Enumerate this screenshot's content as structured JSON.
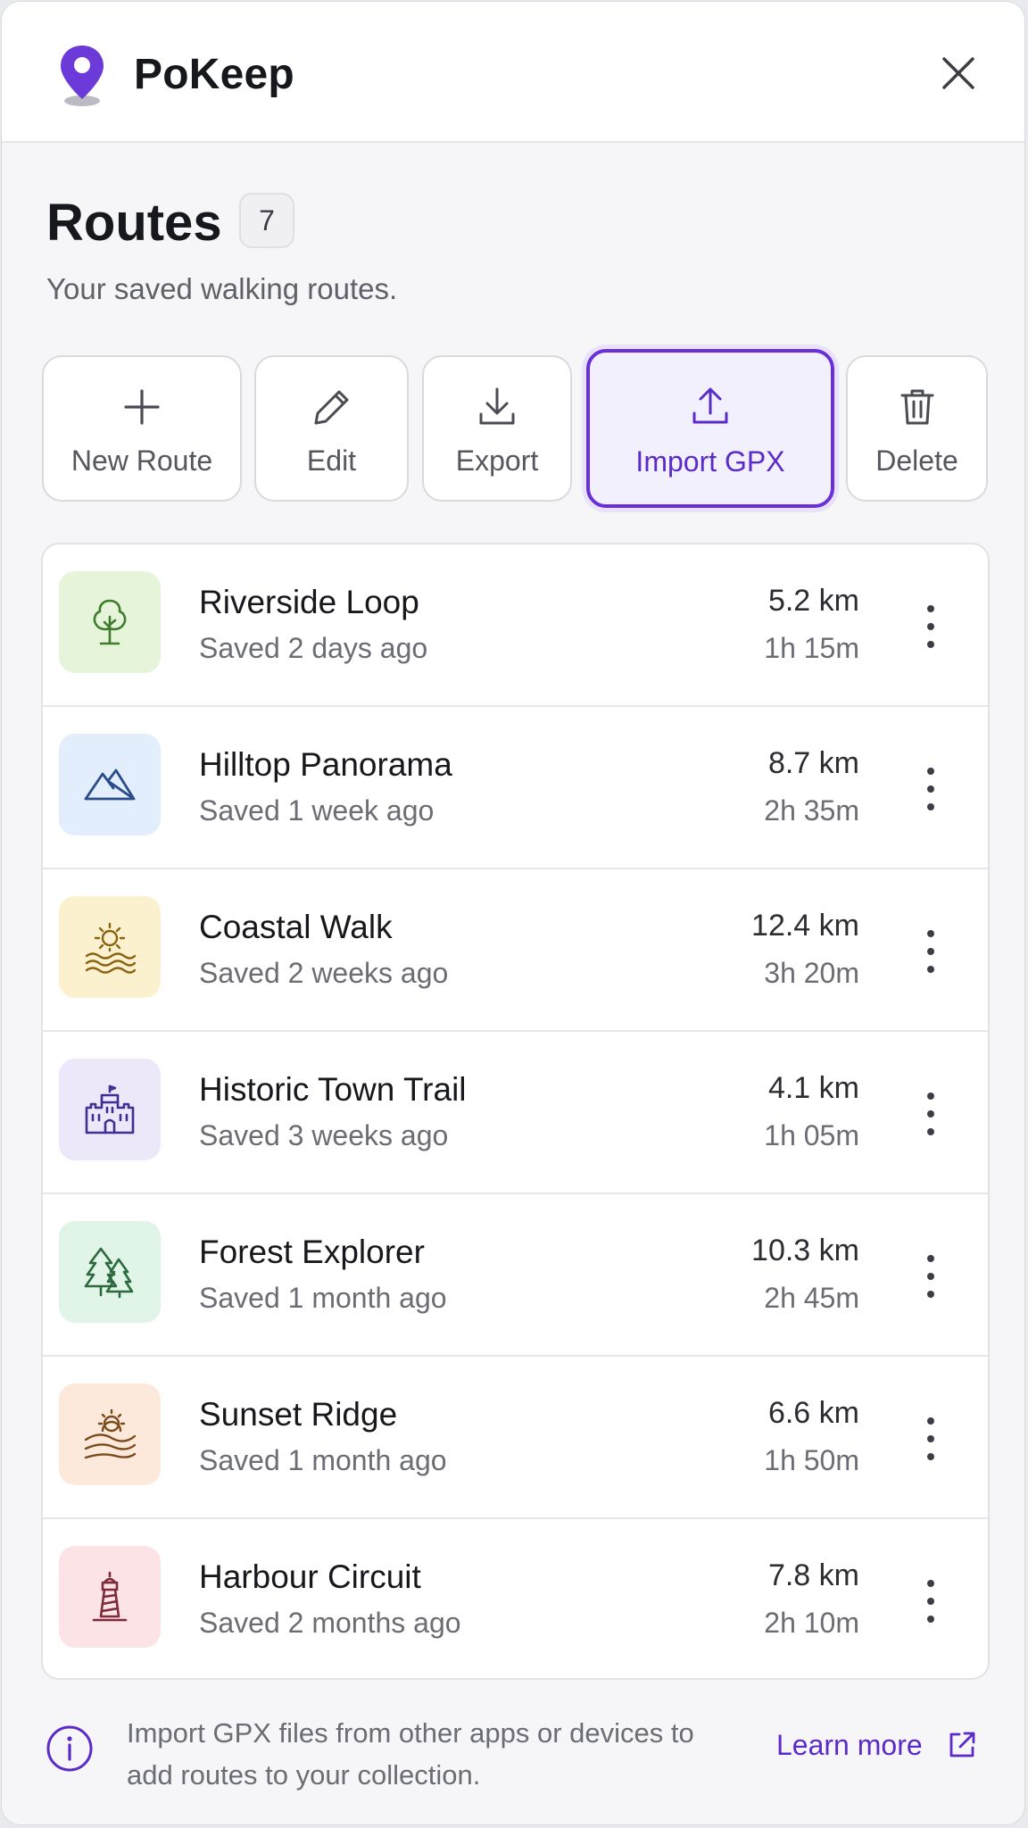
{
  "app": {
    "title": "PoKeep"
  },
  "page": {
    "title": "Routes",
    "count": "7",
    "subtitle": "Your saved walking routes."
  },
  "toolbar": {
    "new_route": "New Route",
    "edit": "Edit",
    "export": "Export",
    "import_gpx": "Import GPX",
    "delete": "Delete",
    "active": "import_gpx"
  },
  "routes": [
    {
      "name": "Riverside Loop",
      "saved": "Saved 2 days ago",
      "distance": "5.2 km",
      "duration": "1h 15m",
      "icon": "tree-icon",
      "tile_color": "#e6f4da",
      "icon_color": "#3e7b2a"
    },
    {
      "name": "Hilltop Panorama",
      "saved": "Saved 1 week ago",
      "distance": "8.7 km",
      "duration": "2h 35m",
      "icon": "mountain-icon",
      "tile_color": "#e3eefc",
      "icon_color": "#2a4c8a"
    },
    {
      "name": "Coastal Walk",
      "saved": "Saved 2 weeks ago",
      "distance": "12.4 km",
      "duration": "3h 20m",
      "icon": "sun-waves-icon",
      "tile_color": "#fcf1cf",
      "icon_color": "#8a6312"
    },
    {
      "name": "Historic Town Trail",
      "saved": "Saved 3 weeks ago",
      "distance": "4.1 km",
      "duration": "1h 05m",
      "icon": "castle-icon",
      "tile_color": "#ece8fa",
      "icon_color": "#3f2f90"
    },
    {
      "name": "Forest Explorer",
      "saved": "Saved 1 month ago",
      "distance": "10.3 km",
      "duration": "2h 45m",
      "icon": "pine-trees-icon",
      "tile_color": "#e0f4e8",
      "icon_color": "#2c6a3e"
    },
    {
      "name": "Sunset Ridge",
      "saved": "Saved 1 month ago",
      "distance": "6.6 km",
      "duration": "1h 50m",
      "icon": "sunset-icon",
      "tile_color": "#fde9db",
      "icon_color": "#7a4a1a"
    },
    {
      "name": "Harbour Circuit",
      "saved": "Saved 2 months ago",
      "distance": "7.8 km",
      "duration": "2h 10m",
      "icon": "lighthouse-icon",
      "tile_color": "#fbe3e6",
      "icon_color": "#7e2a38"
    }
  ],
  "footer": {
    "info_text": "Import GPX files from other apps or devices to add routes to your collection.",
    "learn_more": "Learn more"
  },
  "colors": {
    "accent": "#6a2fd6",
    "brand_pin": "#6b3ad8"
  }
}
